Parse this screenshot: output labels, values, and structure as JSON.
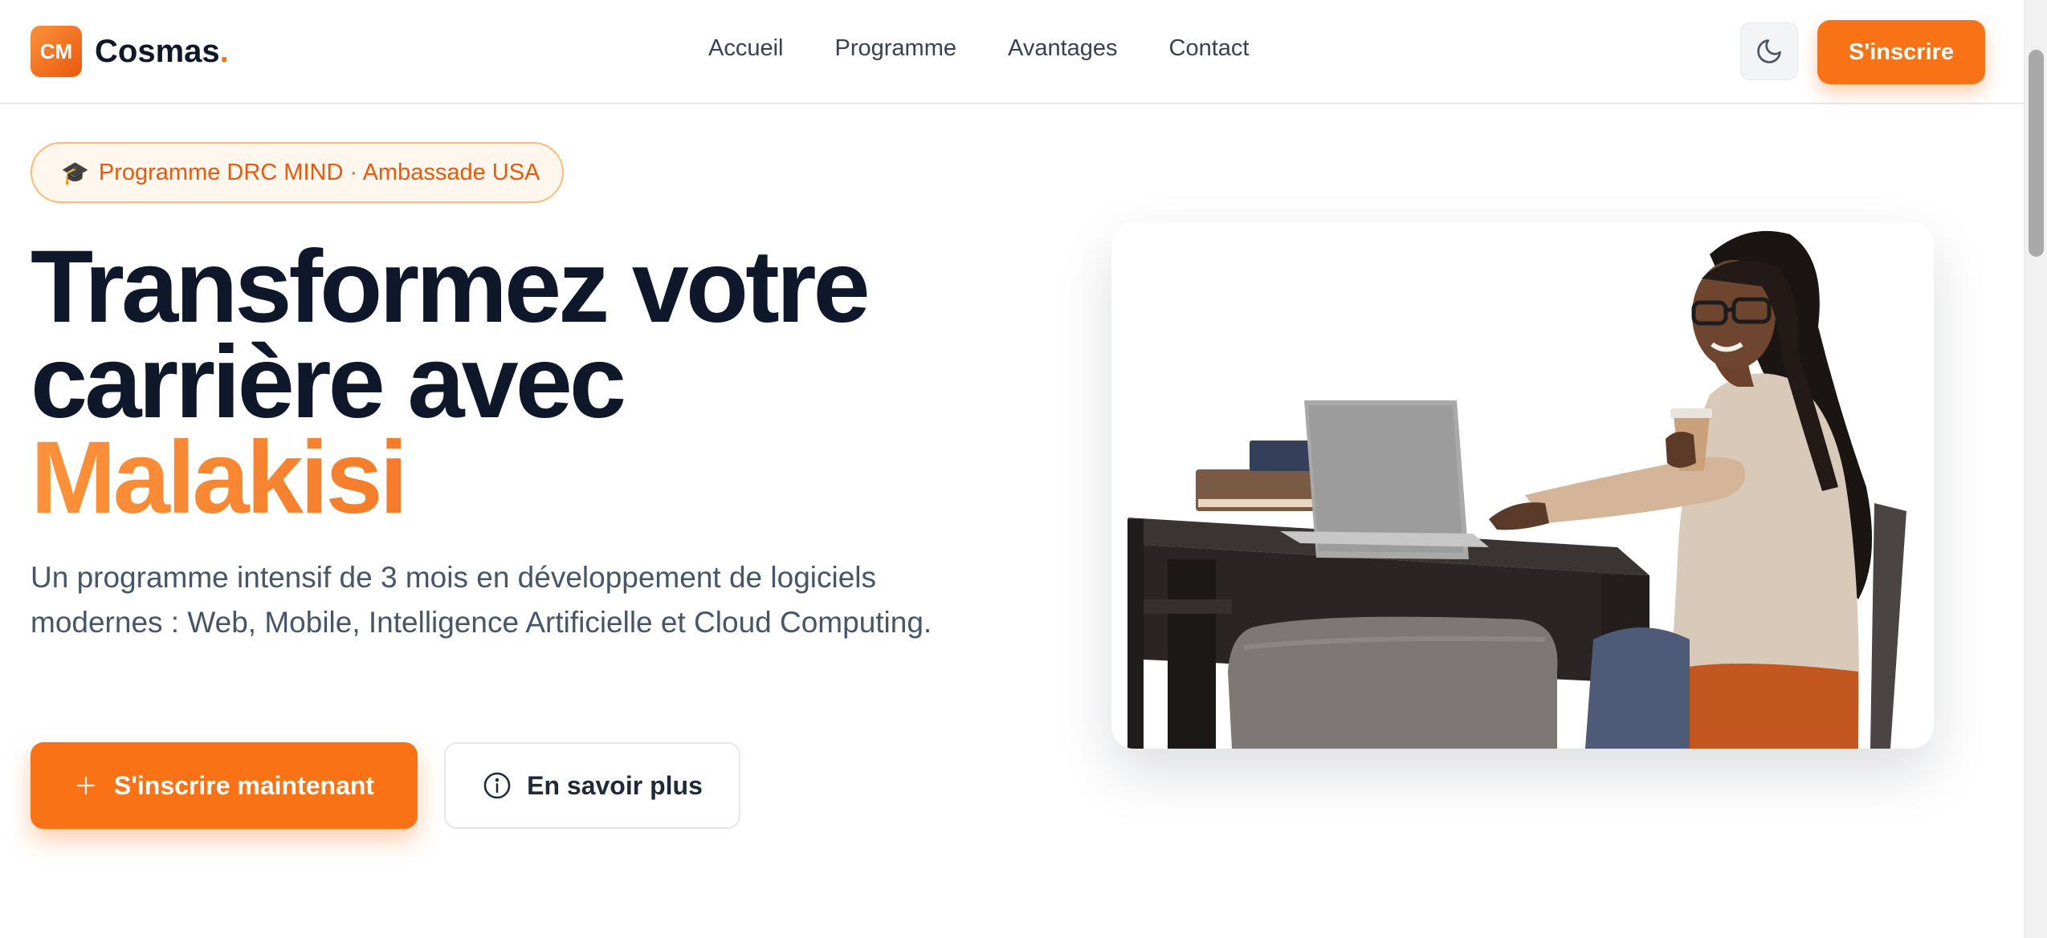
{
  "header": {
    "logo_badge": "CM",
    "logo_name": "Cosmas",
    "logo_dot": ".",
    "nav": [
      {
        "label": "Accueil"
      },
      {
        "label": "Programme"
      },
      {
        "label": "Avantages"
      },
      {
        "label": "Contact"
      }
    ],
    "theme_icon": "moon-icon",
    "cta_label": "S'inscrire"
  },
  "hero": {
    "pill_icon": "🎓",
    "pill_text": "Programme DRC MIND · Ambassade USA",
    "title_line1": "Transformez votre",
    "title_line2": "carrière avec",
    "title_accent": "Malakisi",
    "subtitle": "Un programme intensif de 3 mois en développement de logiciels modernes : Web, Mobile, Intelligence Artificielle et Cloud Computing.",
    "primary_button": {
      "icon": "plus-icon",
      "label": "S'inscrire maintenant"
    },
    "secondary_button": {
      "icon": "info-icon",
      "label": "En savoir plus"
    },
    "image": {
      "subject": "hero-photo-student-laptop"
    }
  },
  "colors": {
    "accent": "#f97316",
    "accent_dark": "#ea580c",
    "heading": "#0f172a",
    "body_text": "#475569"
  }
}
